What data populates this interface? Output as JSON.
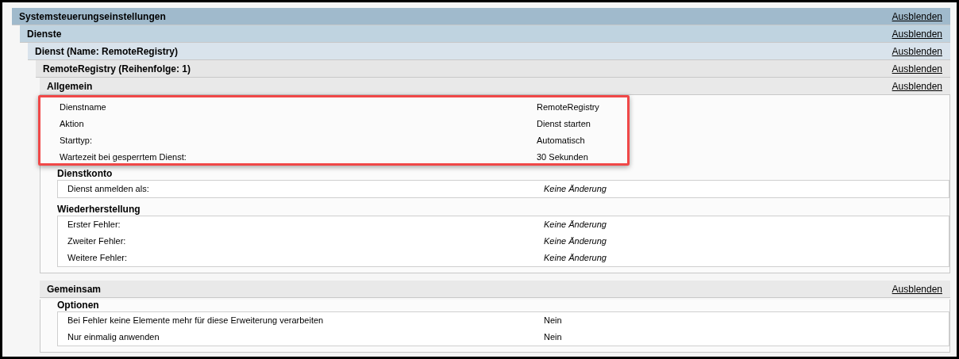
{
  "tree": {
    "title": "Systemsteuerungseinstellungen",
    "link": "Ausblenden",
    "children": [
      {
        "title": "Dienste",
        "link": "Ausblenden",
        "children": [
          {
            "title": "Dienst (Name: RemoteRegistry)",
            "link": "Ausblenden",
            "children": [
              {
                "title": "RemoteRegistry (Reihenfolge: 1)",
                "link": "Ausblenden",
                "children": [
                  {
                    "title": "Allgemein",
                    "link": "Ausblenden",
                    "highlighted": true,
                    "rows": [
                      {
                        "label": "Dienstname",
                        "value": "RemoteRegistry"
                      },
                      {
                        "label": "Aktion",
                        "value": "Dienst starten"
                      },
                      {
                        "label": "Starttyp:",
                        "value": "Automatisch"
                      },
                      {
                        "label": "Wartezeit bei gesperrtem Dienst:",
                        "value": "30 Sekunden"
                      }
                    ],
                    "groups": [
                      {
                        "title": "Dienstkonto",
                        "rows": [
                          {
                            "label": "Dienst anmelden als:",
                            "value": "Keine Änderung",
                            "italic": true
                          }
                        ]
                      },
                      {
                        "title": "Wiederherstellung",
                        "rows": [
                          {
                            "label": "Erster Fehler:",
                            "value": "Keine Änderung",
                            "italic": true
                          },
                          {
                            "label": "Zweiter Fehler:",
                            "value": "Keine Änderung",
                            "italic": true
                          },
                          {
                            "label": "Weitere Fehler:",
                            "value": "Keine Änderung",
                            "italic": true
                          }
                        ]
                      }
                    ]
                  },
                  {
                    "title": "Gemeinsam",
                    "link": "Ausblenden",
                    "groups": [
                      {
                        "title": "Optionen",
                        "rows": [
                          {
                            "label": "Bei Fehler keine Elemente mehr für diese Erweiterung verarbeiten",
                            "value": "Nein"
                          },
                          {
                            "label": "Nur einmalig anwenden",
                            "value": "Nein"
                          }
                        ]
                      }
                    ]
                  }
                ]
              }
            ]
          }
        ]
      }
    ]
  }
}
